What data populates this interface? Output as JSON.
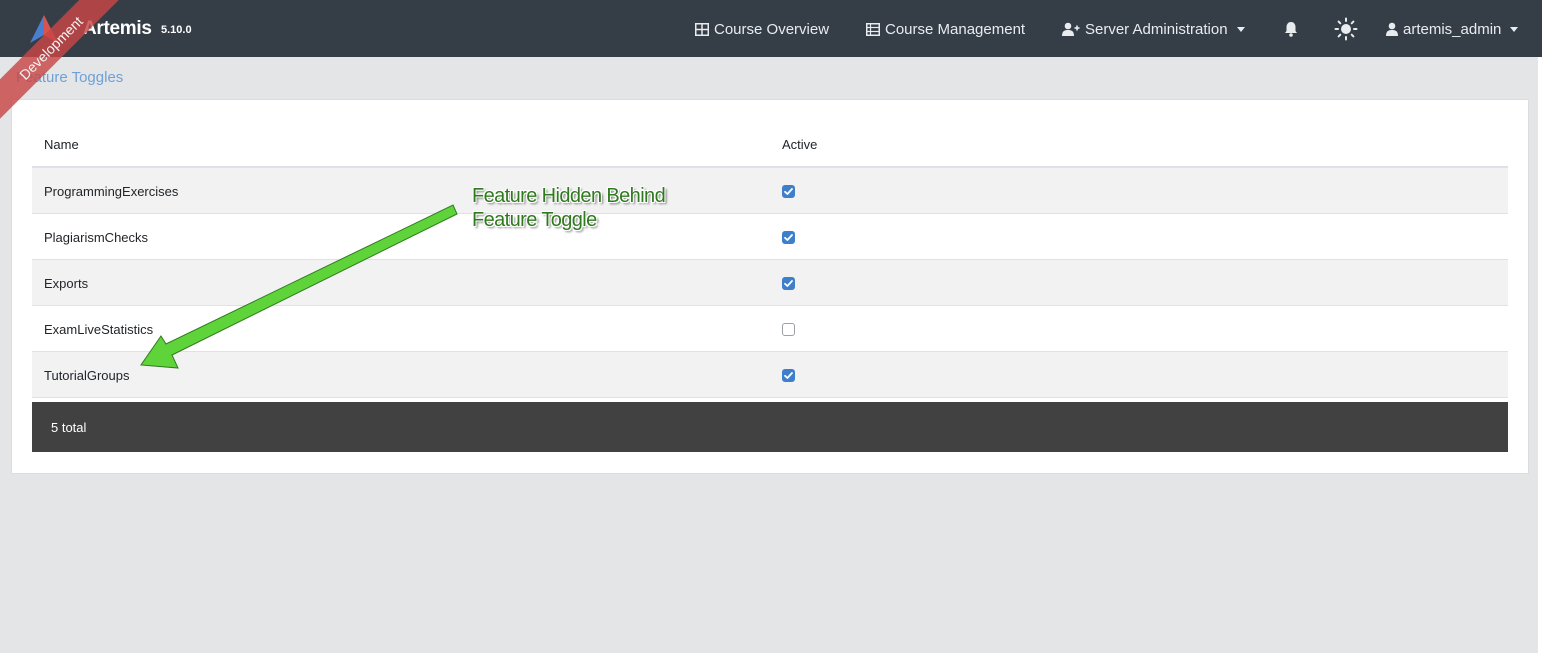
{
  "navbar": {
    "app_name": "Artemis",
    "version": "5.10.0",
    "ribbon": "Development",
    "items": [
      {
        "label": "Course Overview",
        "icon": "grid-icon"
      },
      {
        "label": "Course Management",
        "icon": "table-list-icon"
      },
      {
        "label": "Server Administration",
        "icon": "user-plus-icon",
        "dropdown": true
      },
      {
        "label": "artemis_admin",
        "icon": "user-icon",
        "dropdown": true
      }
    ],
    "icons": [
      "bell-icon",
      "sun-icon"
    ]
  },
  "breadcrumb": "Feature Toggles",
  "table": {
    "columns": [
      "Name",
      "Active"
    ],
    "rows": [
      {
        "name": "ProgrammingExercises",
        "active": true
      },
      {
        "name": "PlagiarismChecks",
        "active": true
      },
      {
        "name": "Exports",
        "active": true
      },
      {
        "name": "ExamLiveStatistics",
        "active": false
      },
      {
        "name": "TutorialGroups",
        "active": true
      }
    ],
    "footer": "5 total"
  },
  "annotation": {
    "line1": "Feature Hidden Behind",
    "line2": "Feature Toggle"
  },
  "colors": {
    "navbar": "#353d47",
    "accent": "#3e7fcc",
    "arrow": "#5fd43a",
    "annotation_text": "#2f7a1e",
    "ribbon": "#c94646"
  }
}
